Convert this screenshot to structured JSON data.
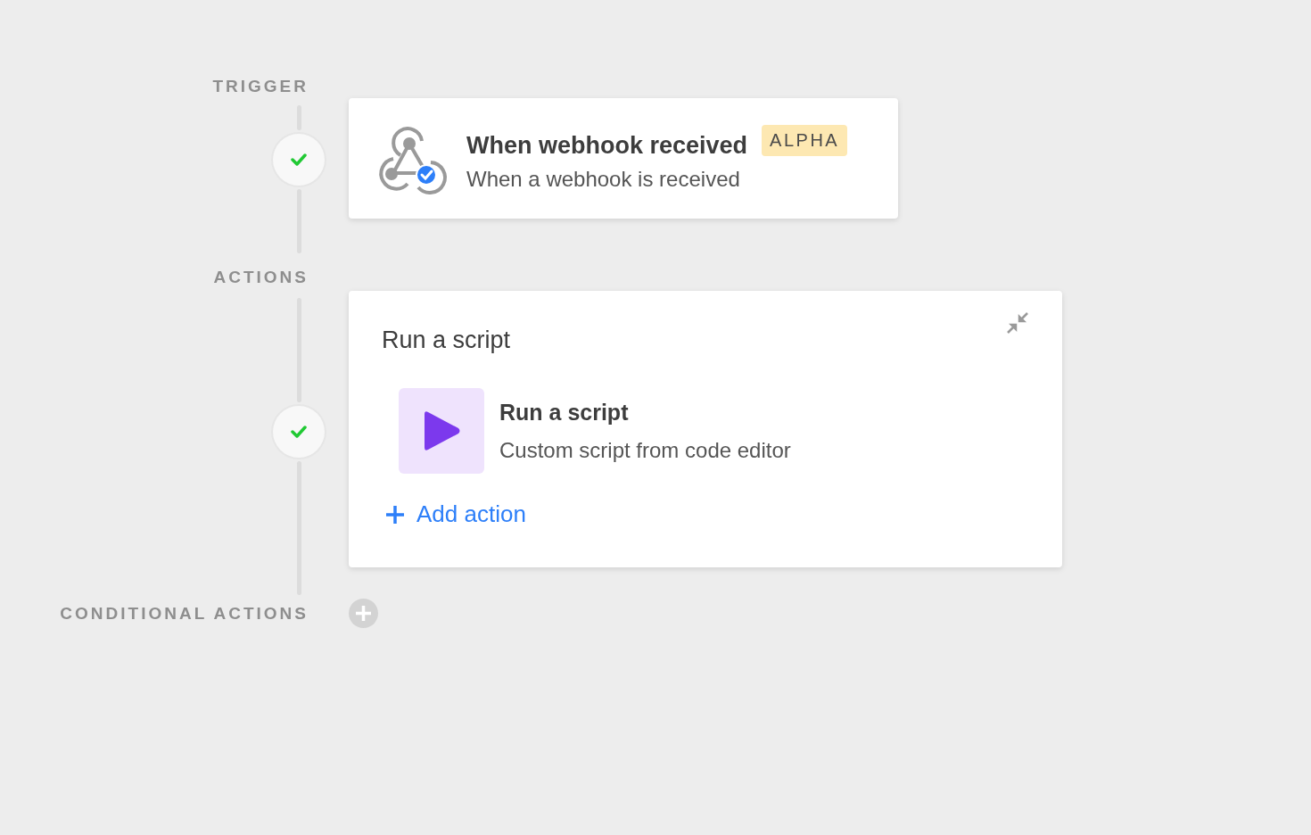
{
  "trigger": {
    "label": "TRIGGER",
    "done": true,
    "title": "When webhook received",
    "badge": "ALPHA",
    "subtitle": "When a webhook is received"
  },
  "actions": {
    "label": "ACTIONS",
    "done": true,
    "title": "Run a script",
    "items": [
      {
        "title": "Run a script",
        "subtitle": "Custom script from code editor"
      }
    ],
    "add_label": "Add action"
  },
  "conditional_actions": {
    "label": "CONDITIONAL ACTIONS"
  }
}
